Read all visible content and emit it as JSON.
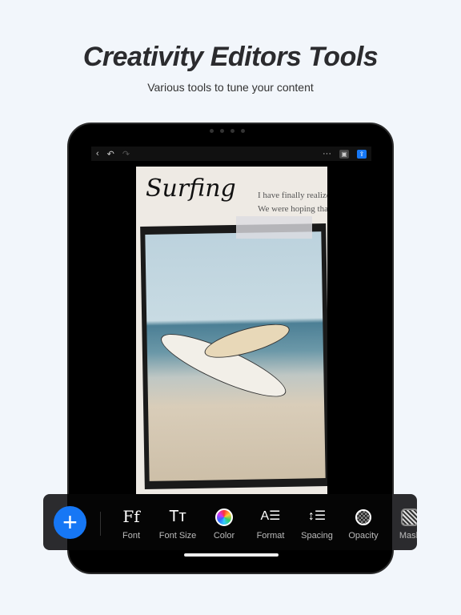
{
  "header": {
    "title": "Creativity Editors Tools",
    "subtitle": "Various tools to tune your content"
  },
  "topbar": {
    "back_icon": "chevron-left-icon",
    "undo_icon": "undo-icon",
    "redo_icon": "redo-icon",
    "more_label": "···",
    "save_icon": "save-icon",
    "export_icon": "share-icon",
    "accent": "#1677f5"
  },
  "canvas": {
    "heading": "Surfing",
    "quote_lines": [
      "I have finally realized",
      "We were hoping that"
    ]
  },
  "toolbar": {
    "add_icon": "plus-icon",
    "tools": [
      {
        "label": "Font",
        "icon": "Ff"
      },
      {
        "label": "Font Size",
        "icon": "Tт"
      },
      {
        "label": "Color",
        "icon": "color-wheel-icon"
      },
      {
        "label": "Format",
        "icon": "A☰"
      },
      {
        "label": "Spacing",
        "icon": "↕☰"
      },
      {
        "label": "Opacity",
        "icon": "opacity-icon"
      },
      {
        "label": "Mask",
        "icon": "mask-icon"
      }
    ]
  }
}
